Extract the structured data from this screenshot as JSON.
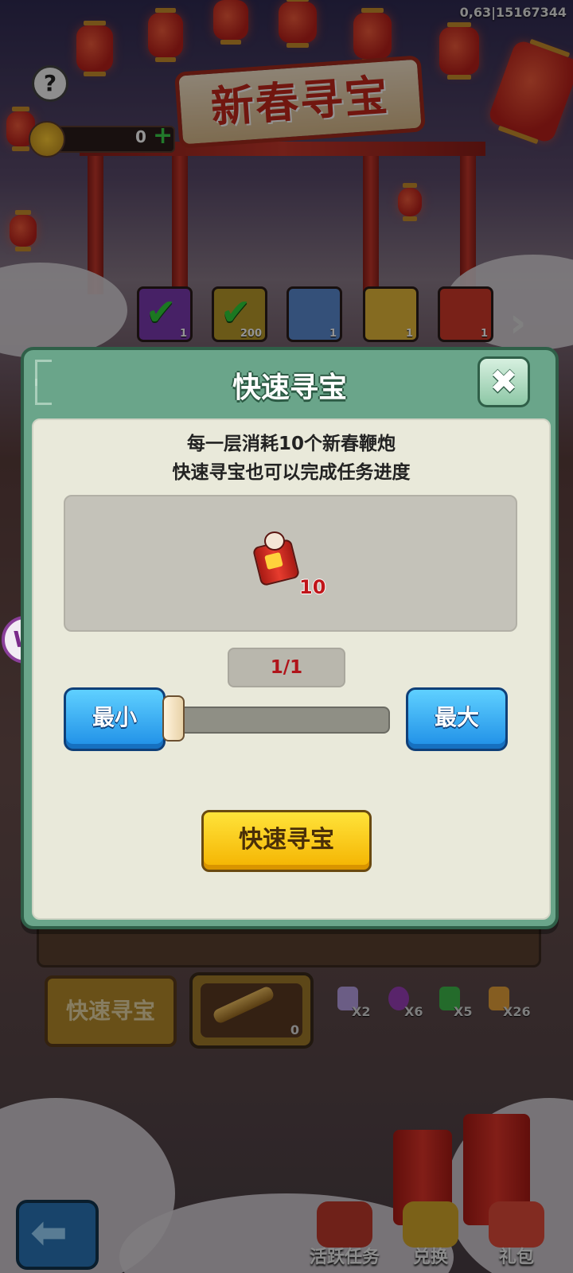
{
  "status": {
    "coords": "0,63|15167344"
  },
  "header": {
    "help_icon": "question-mark",
    "banner_title": "新春寻宝",
    "currency": {
      "icon": "firecracker-coin",
      "value": "0",
      "plus": "+"
    }
  },
  "rewards": [
    {
      "color": "#7a3ab0",
      "claimed": true,
      "count": "1"
    },
    {
      "color": "#b89a2a",
      "claimed": true,
      "count": "200"
    },
    {
      "color": "#5a8ad0",
      "claimed": false,
      "count": "1"
    },
    {
      "color": "#e6b83a",
      "claimed": false,
      "count": "1"
    },
    {
      "color": "#d03a2a",
      "claimed": false,
      "count": "1"
    }
  ],
  "dialog": {
    "title": "快速寻宝",
    "close_icon": "close-x",
    "desc_line1": "每一层消耗10个新春鞭炮",
    "desc_line2": "快速寻宝也可以完成任务进度",
    "cost_item": "firecracker",
    "cost_qty": "10",
    "counter": "1/1",
    "slider_value": 1,
    "slider_max": 1,
    "min_label": "最小",
    "max_label": "最大",
    "confirm_label": "快速寻宝"
  },
  "background_ui": {
    "quick_btn_label": "快速寻宝",
    "telescope_count": "0",
    "gems": [
      {
        "color": "#b9a0e6",
        "count": "X2"
      },
      {
        "color": "#9a3fb8",
        "count": "X6"
      },
      {
        "color": "#3fb84a",
        "count": "X5"
      },
      {
        "color": "#e6a03a",
        "count": "X26"
      }
    ],
    "nav": [
      {
        "label": "活跃任务",
        "color": "#c0392b"
      },
      {
        "label": "兑换",
        "color": "#d4a72a"
      },
      {
        "label": "礼包",
        "color": "#e04a3a"
      }
    ],
    "back_icon": "arrow-left"
  },
  "side_logo": "W"
}
